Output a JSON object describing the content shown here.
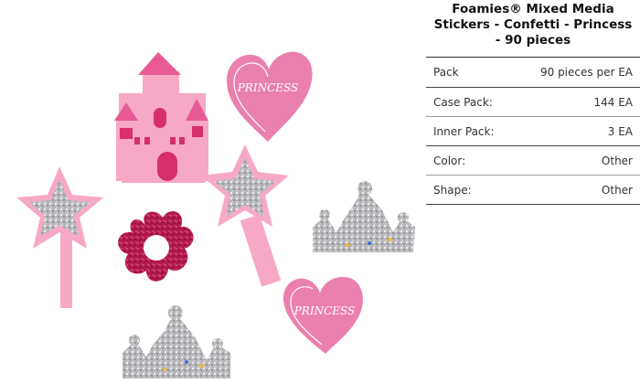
{
  "product": {
    "title": "Foamies® Mixed Media Stickers - Confetti - Princess - 90 pieces",
    "image_text": {
      "heart_top": "PRINCESS",
      "heart_bottom": "PRINCESS"
    }
  },
  "specs": [
    {
      "label": "Pack",
      "value": "90 pieces per EA"
    },
    {
      "label": "Case Pack:",
      "value": "144 EA"
    },
    {
      "label": "Inner Pack:",
      "value": "3 EA"
    },
    {
      "label": "Color:",
      "value": "Other"
    },
    {
      "label": "Shape:",
      "value": "Other"
    }
  ],
  "colors": {
    "pink_light": "#f4a6c4",
    "pink_mid": "#e67ba4",
    "magenta_glitter": "#b0174a",
    "silver_glitter": "#b9b9bd",
    "castle_pink": "#f7a8c6",
    "castle_roof": "#e75a93"
  }
}
